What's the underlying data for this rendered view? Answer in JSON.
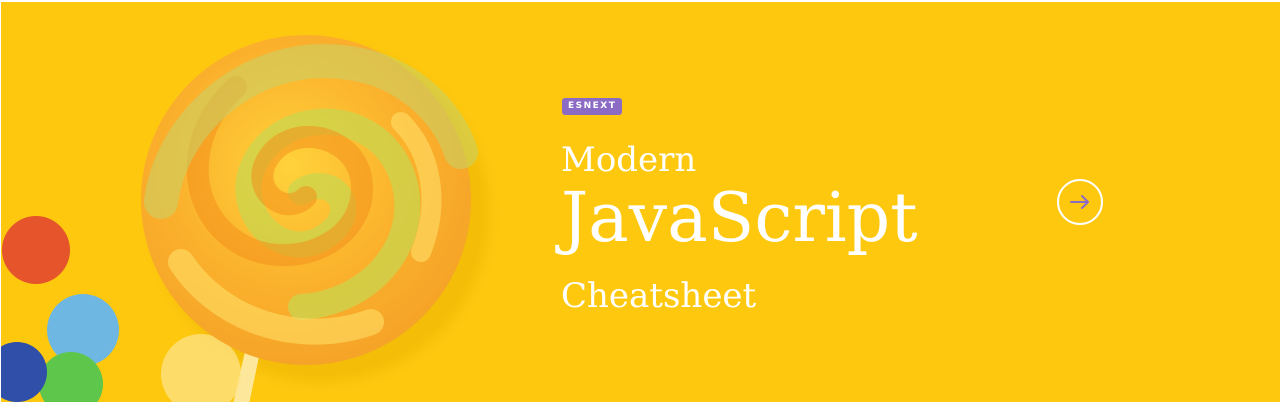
{
  "banner": {
    "badge": "ESNEXT",
    "title_line1": "Modern",
    "title_line2": "JavaScript",
    "title_line3": "Cheatsheet"
  },
  "icons": {
    "arrow": "arrow-right-icon"
  },
  "colors": {
    "background": "#fec80f",
    "badge": "#8c6bc5",
    "text": "#ffffff",
    "arrow": "#8c6bc5"
  }
}
